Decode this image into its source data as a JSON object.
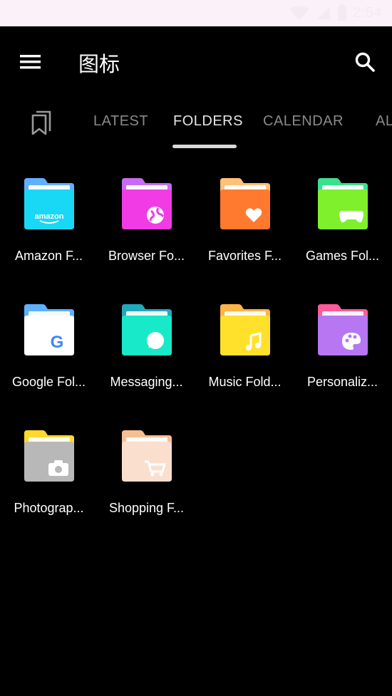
{
  "status_bar": {
    "time": "2:54"
  },
  "app_bar": {
    "title": "图标"
  },
  "tabs": [
    {
      "label": "LATEST"
    },
    {
      "label": "FOLDERS"
    },
    {
      "label": "CALENDAR"
    },
    {
      "label": "AL"
    }
  ],
  "active_tab": "FOLDERS",
  "folders": [
    {
      "label": "Amazon F...",
      "icon": "amazon-folder-icon",
      "color": "#19d8f5",
      "tab_color": "#5fb0ff"
    },
    {
      "label": "Browser Fo...",
      "icon": "browser-folder-icon",
      "color": "#f13be5",
      "tab_color": "#c86bf2"
    },
    {
      "label": "Favorites F...",
      "icon": "favorites-folder-icon",
      "color": "#ff7a2f",
      "tab_color": "#ffc078"
    },
    {
      "label": "Games Fol...",
      "icon": "games-folder-icon",
      "color": "#7ef02c",
      "tab_color": "#3be08e"
    },
    {
      "label": "Google Fol...",
      "icon": "google-folder-icon",
      "color": "#ffffff",
      "tab_color": "#5fb0ff"
    },
    {
      "label": "Messaging...",
      "icon": "messaging-folder-icon",
      "color": "#18e9c8",
      "tab_color": "#23a9bd"
    },
    {
      "label": "Music Fold...",
      "icon": "music-folder-icon",
      "color": "#ffe12b",
      "tab_color": "#ffb447"
    },
    {
      "label": "Personaliz...",
      "icon": "personalize-folder-icon",
      "color": "#b776f2",
      "tab_color": "#ff5b9a"
    },
    {
      "label": "Photograp...",
      "icon": "photography-folder-icon",
      "color": "#b8b8b8",
      "tab_color": "#ffd92c"
    },
    {
      "label": "Shopping F...",
      "icon": "shopping-folder-icon",
      "color": "#fadfcf",
      "tab_color": "#f6bf93"
    }
  ]
}
